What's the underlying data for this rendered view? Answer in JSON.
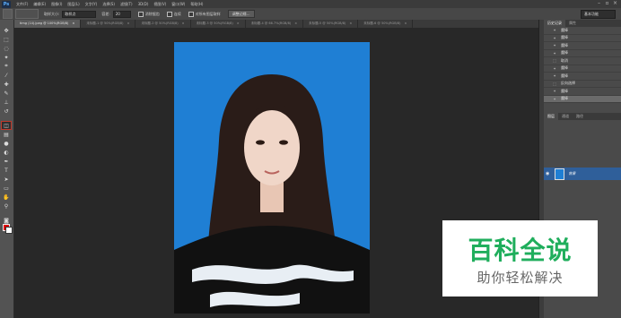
{
  "app": {
    "logo": "Ps"
  },
  "menu": [
    "文件(F)",
    "编辑(E)",
    "图像(I)",
    "图层(L)",
    "文字(Y)",
    "选择(S)",
    "滤镜(T)",
    "3D(D)",
    "视图(V)",
    "窗口(W)",
    "帮助(H)"
  ],
  "options": {
    "sample_size_label": "取样大小:",
    "sample_size_value": "取样点",
    "tolerance_label": "容差:",
    "tolerance_value": "20",
    "antialias_label": "消除锯齿",
    "contiguous_label": "连续",
    "all_layers_label": "对所有图层取样",
    "refine_button": "调整边缘..."
  },
  "workspace": "基本功能",
  "tabs": [
    {
      "label": "timg (14).jpeg @ 100%(RGB/8)",
      "active": true
    },
    {
      "label": "未标题-1 @ 50%(RGB/8)",
      "active": false
    },
    {
      "label": "未标题-2 @ 50%(RGB/8)",
      "active": false
    },
    {
      "label": "未标题-3 @ 50%(RGB/8)",
      "active": false
    },
    {
      "label": "未标题-4 @ 66.7%(RGB/8)",
      "active": false
    },
    {
      "label": "未标题-5 @ 50%(RGB/8)",
      "active": false
    },
    {
      "label": "未标题-6 @ 50%(RGB/8)",
      "active": false
    }
  ],
  "panels": {
    "history_tabs": [
      "历史记录",
      "属性"
    ],
    "history": [
      "魔棒",
      "魔棒",
      "魔棒",
      "魔棒",
      "取消",
      "魔棒",
      "魔棒",
      "反向选择",
      "魔棒",
      "魔棒"
    ],
    "layers_tabs": [
      "图层",
      "通道",
      "路径"
    ],
    "layer_name": "背景"
  },
  "colors": {
    "accent": "#1f7fd4",
    "watermark_green": "#1fae5c",
    "foreground": "#e00000",
    "background": "#ffffff"
  },
  "watermark": {
    "title": "百科全说",
    "subtitle": "助你轻松解决"
  }
}
